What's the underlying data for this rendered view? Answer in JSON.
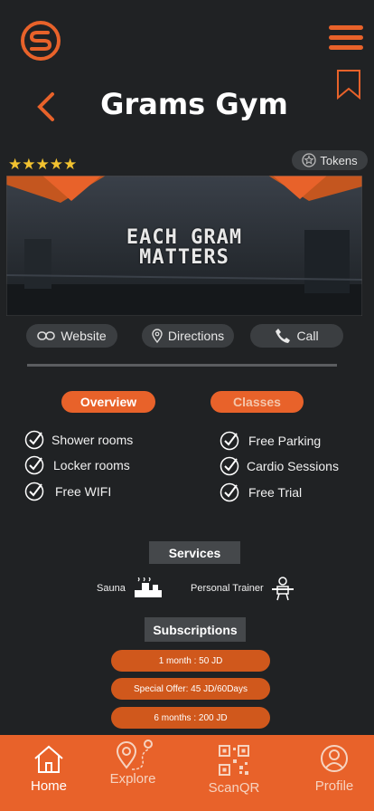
{
  "header": {
    "title": "Grams Gym",
    "logo_icon": "logo-s-icon",
    "menu_icon": "hamburger-menu-icon",
    "bookmark_icon": "bookmark-icon",
    "back_icon": "chevron-left-icon"
  },
  "rating": {
    "stars": "★★★★★",
    "value": 5
  },
  "tokens": {
    "label": "Tokens"
  },
  "banner": {
    "line1": "EACH GRAM",
    "line2": "MATTERS"
  },
  "actions": {
    "website": "Website",
    "directions": "Directions",
    "call": "Call"
  },
  "tabs": {
    "overview": "Overview",
    "classes": "Classes"
  },
  "features": {
    "left": [
      "Shower rooms",
      "Locker rooms",
      "Free WIFI"
    ],
    "right": [
      "Free Parking",
      "Cardio Sessions",
      "Free Trial"
    ]
  },
  "services": {
    "title": "Services",
    "items": [
      "Sauna",
      "Personal Trainer"
    ]
  },
  "subscriptions": {
    "title": "Subscriptions",
    "plans": [
      "1 month : 50 JD",
      "Special Offer: 45 JD/60Days",
      "6 months : 200 JD"
    ]
  },
  "nav": {
    "home": "Home",
    "explore": "Explore",
    "scanqr": "ScanQR",
    "profile": "Profile"
  },
  "colors": {
    "accent": "#e8622a",
    "background": "#202224",
    "star": "#f2c230"
  }
}
